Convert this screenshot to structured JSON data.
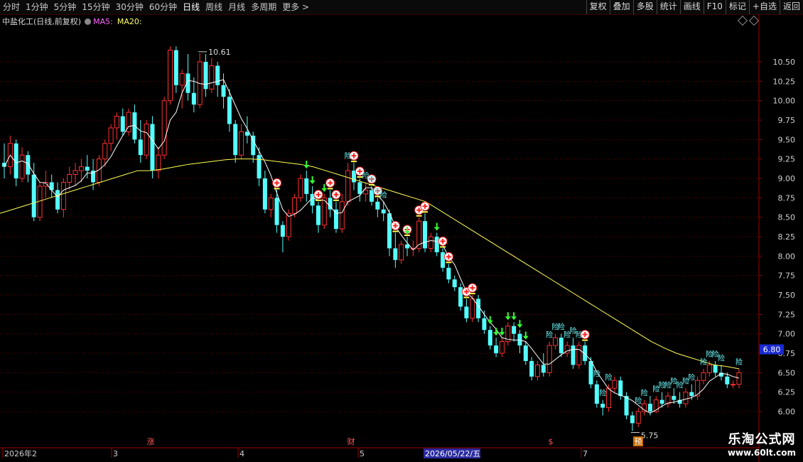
{
  "toolbar": {
    "periods": [
      "分时",
      "1分钟",
      "5分钟",
      "15分钟",
      "30分钟",
      "60分钟",
      "日线",
      "周线",
      "月线",
      "多周期",
      "更多 >"
    ],
    "active_period": "日线",
    "tools": [
      "复权",
      "叠加",
      "多股",
      "统计",
      "画线",
      "F10",
      "标记",
      "+自选",
      "返回"
    ]
  },
  "info": {
    "stock_name": "中盐化工(日线,前复权)",
    "ma5_label": "MA5:",
    "ma20_label": "MA20:"
  },
  "price_axis": {
    "labels": [
      "10.50",
      "10.25",
      "10.00",
      "9.75",
      "9.50",
      "9.25",
      "9.00",
      "8.75",
      "8.50",
      "8.25",
      "8.00",
      "7.75",
      "7.50",
      "7.25",
      "7.00",
      "6.75",
      "6.50",
      "6.25",
      "6.00"
    ],
    "current_price": "6.80"
  },
  "annotations": {
    "high": "10.61",
    "low": "5.75"
  },
  "date_axis": {
    "labels": [
      "2026年2",
      "3",
      "4",
      "5",
      "7"
    ],
    "cursor_date": "2026/05/22/五",
    "event_markers": [
      "涨",
      "财",
      "$",
      "预"
    ]
  },
  "colors": {
    "up": "#ff3232",
    "down": "#54ffff",
    "ma5": "#ffffff",
    "ma20": "#ffff55",
    "grid": "#6a0000"
  },
  "watermark": {
    "line1": "乐淘公式网",
    "line2": "www.60lt.com"
  },
  "chart_data": {
    "type": "candlestick",
    "y_range": [
      5.7,
      10.75
    ],
    "ohlc": [
      [
        9.2,
        9.45,
        9.0,
        9.15
      ],
      [
        9.15,
        9.55,
        9.05,
        9.45
      ],
      [
        9.45,
        9.5,
        8.9,
        9.0
      ],
      [
        9.0,
        9.4,
        8.95,
        9.3
      ],
      [
        9.3,
        9.35,
        8.95,
        9.05
      ],
      [
        9.05,
        9.2,
        8.45,
        8.5
      ],
      [
        8.5,
        8.95,
        8.45,
        8.9
      ],
      [
        8.9,
        9.1,
        8.75,
        8.95
      ],
      [
        8.95,
        9.05,
        8.75,
        8.85
      ],
      [
        8.85,
        8.95,
        8.55,
        8.6
      ],
      [
        8.6,
        9.0,
        8.5,
        8.95
      ],
      [
        8.95,
        9.15,
        8.85,
        9.05
      ],
      [
        9.05,
        9.2,
        8.9,
        9.1
      ],
      [
        9.1,
        9.25,
        8.95,
        9.15
      ],
      [
        9.15,
        9.3,
        9.0,
        9.1
      ],
      [
        9.1,
        9.25,
        8.85,
        8.95
      ],
      [
        8.95,
        9.3,
        8.9,
        9.25
      ],
      [
        9.25,
        9.5,
        9.15,
        9.45
      ],
      [
        9.45,
        9.7,
        9.35,
        9.65
      ],
      [
        9.65,
        9.85,
        9.5,
        9.8
      ],
      [
        9.8,
        9.9,
        9.55,
        9.6
      ],
      [
        9.6,
        9.9,
        9.55,
        9.85
      ],
      [
        9.85,
        9.95,
        9.45,
        9.5
      ],
      [
        9.5,
        9.75,
        9.2,
        9.3
      ],
      [
        9.3,
        9.75,
        9.25,
        9.7
      ],
      [
        9.7,
        9.8,
        9.0,
        9.1
      ],
      [
        9.1,
        9.4,
        9.0,
        9.3
      ],
      [
        9.3,
        10.05,
        9.25,
        10.0
      ],
      [
        10.0,
        10.7,
        9.95,
        10.65
      ],
      [
        10.65,
        10.7,
        10.1,
        10.2
      ],
      [
        10.2,
        10.4,
        9.9,
        10.35
      ],
      [
        10.35,
        10.6,
        10.0,
        10.1
      ],
      [
        10.1,
        10.3,
        9.85,
        9.95
      ],
      [
        9.95,
        10.61,
        9.9,
        10.5
      ],
      [
        10.5,
        10.6,
        10.05,
        10.15
      ],
      [
        10.15,
        10.55,
        10.1,
        10.45
      ],
      [
        10.45,
        10.5,
        10.05,
        10.2
      ],
      [
        10.2,
        10.35,
        9.9,
        10.05
      ],
      [
        10.05,
        10.15,
        9.6,
        9.7
      ],
      [
        9.7,
        9.75,
        9.2,
        9.3
      ],
      [
        9.3,
        9.7,
        9.25,
        9.6
      ],
      [
        9.6,
        9.8,
        9.45,
        9.55
      ],
      [
        9.55,
        9.6,
        9.2,
        9.3
      ],
      [
        9.3,
        9.4,
        8.9,
        9.0
      ],
      [
        9.0,
        9.1,
        8.55,
        8.6
      ],
      [
        8.6,
        8.8,
        8.5,
        8.75
      ],
      [
        8.75,
        8.85,
        8.3,
        8.4
      ],
      [
        8.4,
        8.45,
        8.05,
        8.25
      ],
      [
        8.25,
        8.6,
        8.2,
        8.55
      ],
      [
        8.55,
        8.8,
        8.5,
        8.75
      ],
      [
        8.75,
        9.05,
        8.7,
        9.0
      ],
      [
        9.0,
        9.1,
        8.7,
        8.8
      ],
      [
        8.8,
        8.9,
        8.55,
        8.65
      ],
      [
        8.65,
        8.7,
        8.3,
        8.4
      ],
      [
        8.4,
        8.8,
        8.35,
        8.75
      ],
      [
        8.75,
        8.85,
        8.5,
        8.6
      ],
      [
        8.6,
        8.7,
        8.3,
        8.35
      ],
      [
        8.35,
        8.8,
        8.3,
        8.7
      ],
      [
        8.7,
        9.2,
        8.65,
        9.1
      ],
      [
        9.1,
        9.2,
        8.85,
        8.95
      ],
      [
        8.95,
        9.0,
        8.7,
        8.8
      ],
      [
        8.8,
        8.95,
        8.7,
        8.85
      ],
      [
        8.85,
        8.9,
        8.65,
        8.7
      ],
      [
        8.7,
        8.75,
        8.5,
        8.6
      ],
      [
        8.6,
        8.7,
        8.45,
        8.55
      ],
      [
        8.55,
        8.6,
        8.0,
        8.1
      ],
      [
        8.1,
        8.3,
        7.85,
        7.95
      ],
      [
        7.95,
        8.2,
        7.9,
        8.15
      ],
      [
        8.15,
        8.25,
        8.0,
        8.1
      ],
      [
        8.1,
        8.2,
        8.0,
        8.1
      ],
      [
        8.1,
        8.5,
        8.05,
        8.45
      ],
      [
        8.45,
        8.55,
        8.05,
        8.1
      ],
      [
        8.1,
        8.3,
        8.05,
        8.25
      ],
      [
        8.25,
        8.3,
        8.0,
        8.05
      ],
      [
        8.05,
        8.1,
        7.8,
        7.85
      ],
      [
        7.85,
        7.9,
        7.65,
        7.7
      ],
      [
        7.7,
        7.75,
        7.55,
        7.6
      ],
      [
        7.6,
        7.65,
        7.3,
        7.35
      ],
      [
        7.35,
        7.45,
        7.15,
        7.2
      ],
      [
        7.2,
        7.5,
        7.15,
        7.45
      ],
      [
        7.45,
        7.5,
        7.15,
        7.2
      ],
      [
        7.2,
        7.3,
        7.0,
        7.05
      ],
      [
        7.05,
        7.1,
        6.8,
        6.85
      ],
      [
        6.85,
        6.95,
        6.7,
        6.75
      ],
      [
        6.75,
        6.95,
        6.7,
        6.9
      ],
      [
        6.9,
        7.15,
        6.85,
        7.1
      ],
      [
        7.1,
        7.15,
        6.9,
        7.0
      ],
      [
        7.0,
        7.05,
        6.75,
        6.85
      ],
      [
        6.85,
        6.9,
        6.6,
        6.65
      ],
      [
        6.65,
        6.7,
        6.4,
        6.45
      ],
      [
        6.45,
        6.65,
        6.4,
        6.6
      ],
      [
        6.6,
        6.75,
        6.45,
        6.5
      ],
      [
        6.5,
        6.9,
        6.45,
        6.85
      ],
      [
        6.85,
        7.0,
        6.8,
        6.95
      ],
      [
        6.95,
        7.0,
        6.7,
        6.75
      ],
      [
        6.75,
        6.9,
        6.7,
        6.85
      ],
      [
        6.85,
        6.95,
        6.55,
        6.6
      ],
      [
        6.6,
        6.9,
        6.55,
        6.85
      ],
      [
        6.85,
        6.9,
        6.6,
        6.65
      ],
      [
        6.65,
        6.7,
        6.3,
        6.35
      ],
      [
        6.35,
        6.4,
        6.05,
        6.1
      ],
      [
        6.1,
        6.15,
        5.95,
        6.05
      ],
      [
        6.05,
        6.35,
        6.0,
        6.3
      ],
      [
        6.3,
        6.45,
        6.25,
        6.4
      ],
      [
        6.4,
        6.45,
        6.15,
        6.2
      ],
      [
        6.2,
        6.25,
        5.9,
        5.95
      ],
      [
        5.95,
        6.0,
        5.75,
        5.85
      ],
      [
        5.85,
        6.05,
        5.8,
        6.0
      ],
      [
        6.0,
        6.15,
        5.95,
        6.1
      ],
      [
        6.1,
        6.2,
        5.95,
        6.0
      ],
      [
        6.0,
        6.2,
        5.98,
        6.15
      ],
      [
        6.15,
        6.25,
        6.05,
        6.1
      ],
      [
        6.1,
        6.25,
        6.05,
        6.2
      ],
      [
        6.2,
        6.3,
        6.1,
        6.15
      ],
      [
        6.15,
        6.25,
        6.05,
        6.1
      ],
      [
        6.1,
        6.3,
        6.05,
        6.25
      ],
      [
        6.25,
        6.35,
        6.15,
        6.2
      ],
      [
        6.2,
        6.45,
        6.15,
        6.4
      ],
      [
        6.4,
        6.55,
        6.35,
        6.5
      ],
      [
        6.5,
        6.65,
        6.45,
        6.6
      ],
      [
        6.6,
        6.65,
        6.45,
        6.5
      ],
      [
        6.5,
        6.6,
        6.4,
        6.45
      ],
      [
        6.45,
        6.5,
        6.3,
        6.35
      ],
      [
        6.35,
        6.4,
        6.3,
        6.35
      ],
      [
        6.35,
        6.55,
        6.3,
        6.5
      ]
    ],
    "ma20": [
      8.55,
      8.6,
      8.65,
      8.7,
      8.75,
      8.8,
      8.85,
      8.9,
      8.95,
      9.0,
      9.05,
      9.1,
      9.1,
      9.12,
      9.15,
      9.18,
      9.2,
      9.22,
      9.24,
      9.25,
      9.25,
      9.24,
      9.22,
      9.2,
      9.18,
      9.15,
      9.1,
      9.05,
      9.0,
      8.95,
      8.9,
      8.85,
      8.8,
      8.75,
      8.7,
      8.6,
      8.5,
      8.4,
      8.3,
      8.2,
      8.1,
      8.0,
      7.9,
      7.8,
      7.7,
      7.6,
      7.5,
      7.4,
      7.3,
      7.2,
      7.1,
      7.0,
      6.9,
      6.82,
      6.75,
      6.7,
      6.65,
      6.6,
      6.58,
      6.55
    ]
  }
}
